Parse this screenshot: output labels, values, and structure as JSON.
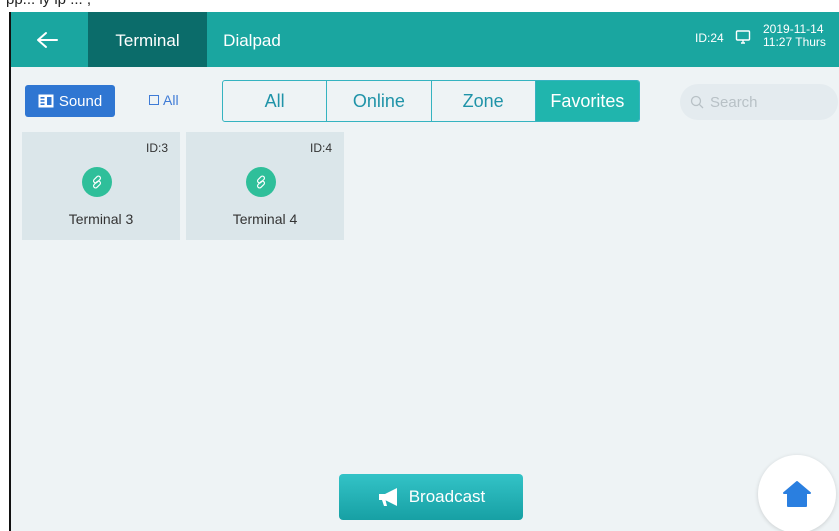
{
  "caption_fragment": "pp... ly  ip ... ,",
  "header": {
    "tabs": [
      {
        "label": "Terminal",
        "active": true
      },
      {
        "label": "Dialpad",
        "active": false
      }
    ],
    "device_id": "ID:24",
    "date": "2019-11-14",
    "time_day": "11:27 Thurs"
  },
  "toolbar": {
    "sound_label": "Sound",
    "all_check_label": "All",
    "filters": [
      "All",
      "Online",
      "Zone",
      "Favorites"
    ],
    "active_filter": "Favorites",
    "search_placeholder": "Search"
  },
  "terminals": [
    {
      "id": "ID:3",
      "name": "Terminal 3"
    },
    {
      "id": "ID:4",
      "name": "Terminal 4"
    }
  ],
  "footer": {
    "broadcast_label": "Broadcast"
  },
  "colors": {
    "header": "#1aa6a0",
    "active_tab": "#0b6c6a",
    "sound_button": "#2f76d2",
    "filter_active": "#20b5ad",
    "link_icon": "#2fbf9a",
    "home_icon": "#2a7fe0"
  }
}
